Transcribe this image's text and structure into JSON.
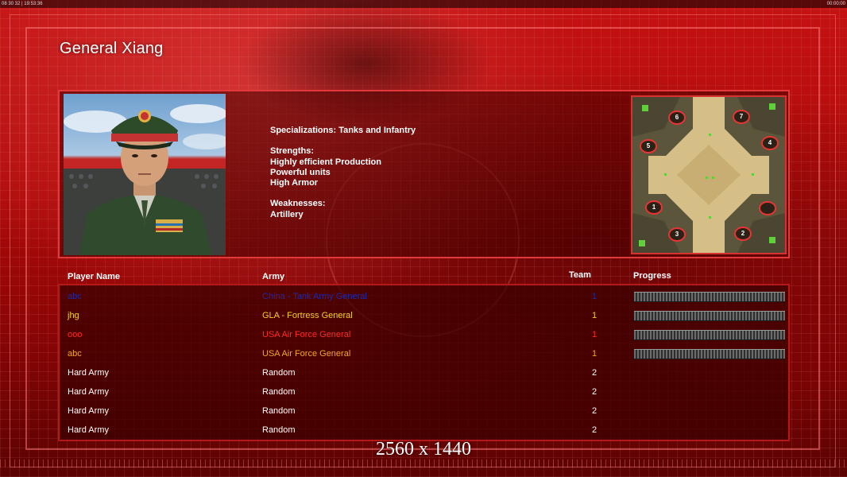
{
  "topbar": {
    "left_text": "08 30 32 | 19:53:36",
    "right_text": "00:00:00"
  },
  "general": {
    "title": "General Xiang",
    "specializations": "Specializations: Tanks and Infantry",
    "strengths_heading": "Strengths:",
    "strengths": [
      "Highly efficient Production",
      "Powerful units",
      "High Armor"
    ],
    "weaknesses_heading": "Weaknesses:",
    "weaknesses": [
      "Artillery"
    ]
  },
  "map": {
    "spawns": [
      "6",
      "7",
      "5",
      "4",
      "1",
      "",
      "3",
      "2"
    ]
  },
  "table": {
    "headers": {
      "player_name": "Player Name",
      "army": "Army",
      "team": "Team",
      "progress": "Progress"
    },
    "rows": [
      {
        "name": "abc",
        "army": "China - Tank Army General",
        "team": "1",
        "color": "#1f2aa8",
        "progress": 1
      },
      {
        "name": "jhg",
        "army": "GLA - Fortress General",
        "team": "1",
        "color": "#f4d020",
        "progress": 1
      },
      {
        "name": "ooo",
        "army": "USA Air Force General",
        "team": "1",
        "color": "#ff2a2a",
        "progress": 1
      },
      {
        "name": "abc",
        "army": "USA Air Force General",
        "team": "1",
        "color": "#f3a623",
        "progress": 1
      },
      {
        "name": "Hard Army",
        "army": "Random",
        "team": "2",
        "color": "#ffffff",
        "progress": null
      },
      {
        "name": "Hard Army",
        "army": "Random",
        "team": "2",
        "color": "#ffffff",
        "progress": null
      },
      {
        "name": "Hard Army",
        "army": "Random",
        "team": "2",
        "color": "#ffffff",
        "progress": null
      },
      {
        "name": "Hard Army",
        "army": "Random",
        "team": "2",
        "color": "#ffffff",
        "progress": null
      }
    ]
  },
  "resolution_label": "2560 x 1440"
}
